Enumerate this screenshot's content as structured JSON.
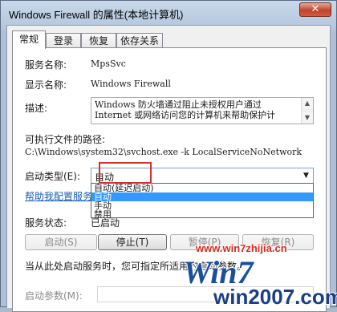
{
  "window": {
    "title": "Windows Firewall 的属性(本地计算机)",
    "close_label": "✕"
  },
  "tabs": [
    {
      "label": "常规",
      "active": true
    },
    {
      "label": "登录",
      "active": false
    },
    {
      "label": "恢复",
      "active": false
    },
    {
      "label": "依存关系",
      "active": false
    }
  ],
  "general": {
    "service_name_label": "服务名称:",
    "service_name": "MpsSvc",
    "display_name_label": "显示名称:",
    "display_name": "Windows Firewall",
    "description_label": "描述:",
    "description_lines": [
      "Windows 防火墙通过阻止未授权用户通过",
      "Internet 或网络访问您的计算机来帮助保护计"
    ],
    "path_label": "可执行文件的路径:",
    "path": "C:\\Windows\\system32\\svchost.exe -k LocalServiceNoNetwork",
    "startup_type_label": "启动类型(E):",
    "startup_type": "自动",
    "startup_options": [
      "自动(延迟启动)",
      "自动",
      "手动",
      "禁用"
    ],
    "startup_selected_index": 1,
    "help_link": "帮助我配置服务启动选项。",
    "status_label": "服务状态:",
    "status": "已启动",
    "buttons": {
      "start": "启动(S)",
      "stop": "停止(T)",
      "pause": "暂停(P)",
      "resume": "恢复(R)"
    },
    "hint": "当从此处启动服务时，您可指定所适用的启动参数。",
    "params_label": "启动参数(M):"
  },
  "watermark": {
    "url": "www.win7zhijia.cn",
    "logo_text": "Win7",
    "site_text": "win2007.com"
  },
  "colors": {
    "highlight_box": "#d0312d",
    "selection": "#3399ff",
    "link": "#1c5fb5"
  }
}
